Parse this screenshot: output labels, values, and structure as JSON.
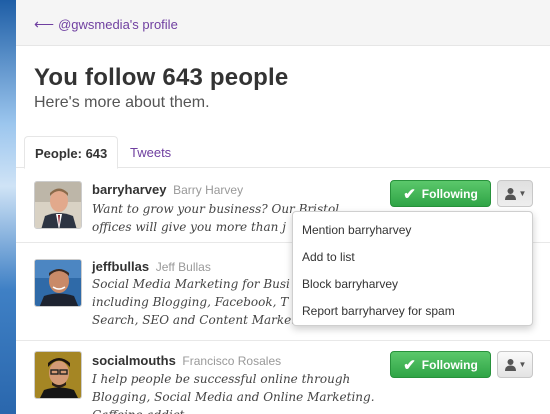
{
  "nav": {
    "back_label": "@gwsmedia's profile"
  },
  "header": {
    "title": "You follow 643 people",
    "subtitle": "Here's more about them."
  },
  "tabs": [
    {
      "label": "People: 643",
      "active": true
    },
    {
      "label": "Tweets",
      "active": false
    }
  ],
  "users": [
    {
      "screen_name": "barryharvey",
      "full_name": "Barry Harvey",
      "bio_lines": [
        "Want to grow your business? Our Bristol",
        "offices will give you more than j"
      ],
      "following_label": "Following"
    },
    {
      "screen_name": "jeffbullas",
      "full_name": "Jeff Bullas",
      "bio_lines": [
        "Social Media Marketing for Busi",
        "including Blogging, Facebook, T",
        "Search, SEO and Content Marketi"
      ]
    },
    {
      "screen_name": "socialmouths",
      "full_name": "Francisco Rosales",
      "bio_lines": [
        "I help people be successful online through",
        "Blogging, Social Media and Online Marketing. Caffeine addict."
      ],
      "following_label": "Following"
    }
  ],
  "dropdown": {
    "items": [
      "Mention barryharvey",
      "Add to list",
      "Block barryharvey",
      "Report barryharvey for spam"
    ]
  },
  "colors": {
    "link": "#6f3fa0",
    "following_button": "#2fa446",
    "page_bg": "#4e8fd0"
  }
}
